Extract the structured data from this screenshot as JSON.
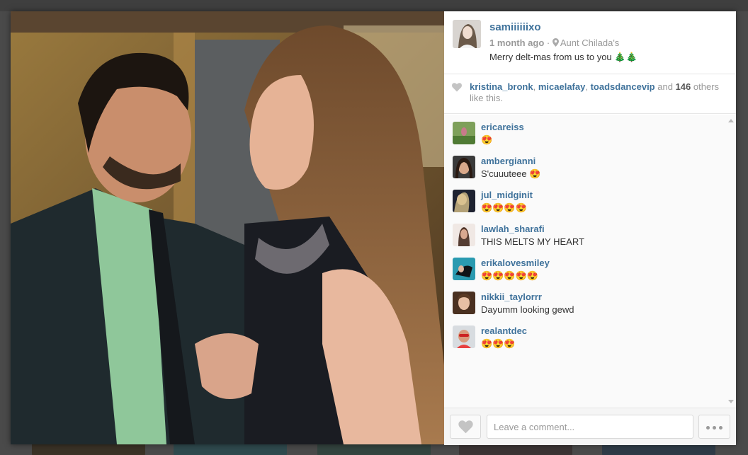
{
  "post": {
    "username": "samiiiiiixo",
    "time": "1 month ago",
    "separator": "·",
    "location": "Aunt Chilada's",
    "caption": "Merry delt-mas from us to you 🎄🎄"
  },
  "likes": {
    "users": [
      "kristina_bronk",
      "micaelafay",
      "toadsdancevip"
    ],
    "comma": ",",
    "and_text": "and",
    "count": "146",
    "suffix": "others like this."
  },
  "comments": [
    {
      "user": "ericareiss",
      "text": "😍"
    },
    {
      "user": "ambergianni",
      "text": "S'cuuuteee 😍"
    },
    {
      "user": "jul_midginit",
      "text": "😍😍😍😍"
    },
    {
      "user": "lawlah_sharafi",
      "text": "THIS MELTS MY HEART"
    },
    {
      "user": "erikalovesmiley",
      "text": "😍😍😍😍😍"
    },
    {
      "user": "nikkii_taylorrr",
      "text": "Dayumm looking gewd"
    },
    {
      "user": "realantdec",
      "text": "😍😍😍"
    }
  ],
  "footer": {
    "comment_placeholder": "Leave a comment..."
  },
  "icons": {
    "heart": "heart-icon",
    "location": "map-pin-icon",
    "more": "more-dots-icon"
  },
  "colors": {
    "link": "#3f729b",
    "muted": "#999999",
    "text": "#333333",
    "overlay": "#4a4a4a"
  }
}
